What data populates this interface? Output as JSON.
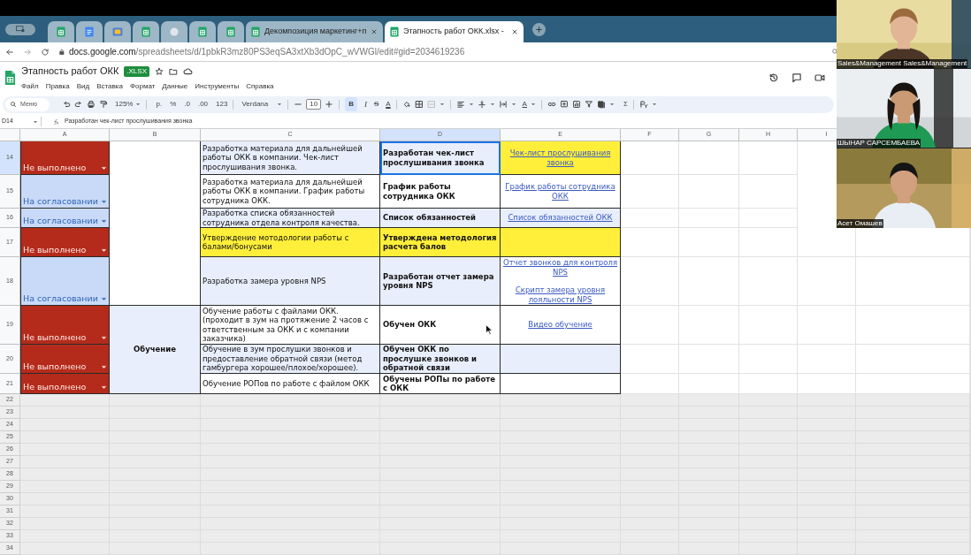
{
  "browser": {
    "tabs": [
      {
        "kind": "sheets",
        "selected": false
      },
      {
        "kind": "docs",
        "selected": false
      },
      {
        "kind": "slides",
        "selected": false
      },
      {
        "kind": "sheets",
        "selected": false
      },
      {
        "kind": "site",
        "selected": false
      },
      {
        "kind": "sheets",
        "selected": false
      },
      {
        "kind": "sheets",
        "selected": false
      },
      {
        "kind": "sheets",
        "title": "Декомпозиция маркетинг+п",
        "selected": false
      },
      {
        "kind": "sheets",
        "title": "Этапность работ ОКК.xlsx -",
        "selected": true
      }
    ],
    "address": {
      "host": "docs.google.com",
      "path": "/spreadsheets/d/1pbkR3mz80PS3eqSA3xtXb3dOpC_wVWGl/edit#gid=2034619236"
    }
  },
  "document": {
    "title": "Этапность работ ОКК",
    "badge": ".XLSX"
  },
  "menu": [
    "Файл",
    "Правка",
    "Вид",
    "Вставка",
    "Формат",
    "Данные",
    "Инструменты",
    "Справка"
  ],
  "toolbar": {
    "search": "Меню",
    "zoom": "125%",
    "currency": "р.",
    "percent": "%",
    "decimal_less": ".0",
    "decimal_more": ".00",
    "number_format": "123",
    "font": "Verdana",
    "font_size": "10",
    "bold": {
      "label": "B",
      "on": true
    },
    "italic": "I",
    "strikethrough": "S",
    "text_color": "A",
    "text_rotation": "A",
    "functions": "Σ"
  },
  "formula_bar": {
    "cell": "D14",
    "value": "Разработан чек-лист прослушивания звонка"
  },
  "columns": [
    {
      "label": "A",
      "selected": false
    },
    {
      "label": "B",
      "selected": false
    },
    {
      "label": "C",
      "selected": false
    },
    {
      "label": "D",
      "selected": true
    },
    {
      "label": "E",
      "selected": false
    },
    {
      "label": "F",
      "selected": false
    },
    {
      "label": "G",
      "selected": false
    },
    {
      "label": "H",
      "selected": false
    },
    {
      "label": "I",
      "selected": false
    }
  ],
  "sections": [
    {
      "rows": [
        {
          "number": "14",
          "selected": true,
          "status": {
            "text": "Не выполнено",
            "kind": "not_done"
          },
          "task": {
            "text": "Разработка материала для дальнейшей работы ОКК в компании. Чек-лист прослушивания звонка.",
            "color": "#e8eefb"
          },
          "result": {
            "text": "Разработан чек-лист прослушивания звонка",
            "color": "#e8eefb",
            "selected": true
          },
          "links": {
            "items": [
              "Чек-лист прослушивания звонка"
            ],
            "color": "#ffef3a"
          }
        },
        {
          "number": "15",
          "selected": false,
          "status": {
            "text": "На согласовании",
            "kind": "in_review"
          },
          "task": {
            "text": "Разработка материала для дальнейшей работы ОКК в компании. График работы сотрудника ОКК.",
            "color": "#ffffff"
          },
          "result": {
            "text": "График работы сотрудника ОКК",
            "color": "#ffffff",
            "selected": false
          },
          "links": {
            "items": [
              "График работы сотрудника ОКК"
            ],
            "color": "#ffffff"
          }
        },
        {
          "number": "16",
          "selected": false,
          "status": {
            "text": "На согласовании",
            "kind": "in_review"
          },
          "task": {
            "text": "Разработка списка обязанностей сотрудника отдела контроля качества.",
            "color": "#e8eefb"
          },
          "result": {
            "text": "Список обязанностей",
            "color": "#e8eefb",
            "selected": false
          },
          "links": {
            "items": [
              "Список обязанностей ОКК"
            ],
            "color": "#e8eefb"
          }
        },
        {
          "number": "17",
          "selected": false,
          "status": {
            "text": "Не выполнено",
            "kind": "not_done"
          },
          "task": {
            "text": "Утверждение мотодологии работы с балами/бонусами",
            "color": "#ffef3a"
          },
          "result": {
            "text": "Утверждена методология расчета балов",
            "color": "#ffef3a",
            "selected": false
          },
          "links": {
            "color": "#ffef3a"
          }
        },
        {
          "number": "18",
          "selected": false,
          "status": {
            "text": "На согласовании",
            "kind": "in_review"
          },
          "task": {
            "text": "Разработка замера уровня NPS",
            "color": "#e8eefb"
          },
          "result": {
            "text": "Разработан отчет замера уровня NPS",
            "color": "#e8eefb",
            "selected": false
          },
          "links": {
            "items": [
              "Отчет звонков для контроля NPS",
              "Скрипт замера уровня лояльности NPS"
            ],
            "color": "#ffffff"
          }
        }
      ]
    },
    {
      "label": "Обучение",
      "rows": [
        {
          "number": "19",
          "selected": false,
          "status": {
            "text": "Не выполнено",
            "kind": "not_done"
          },
          "task": {
            "text": "Обучение работы с файлами ОКК. (проходит в зум на протяжение 2 часов с ответственным за ОКК и с компании заказчика)",
            "color": "#ffffff"
          },
          "result": {
            "text": "Обучен ОКК",
            "color": "#ffffff",
            "selected": false
          },
          "links": {
            "items": [
              "Видео обучение"
            ],
            "color": "#ffffff"
          }
        },
        {
          "number": "20",
          "selected": false,
          "status": {
            "text": "Не выполнено",
            "kind": "not_done"
          },
          "task": {
            "text": "Обучение в зум прослушки звонков и предоставление обратной связи (метод гамбургера хорошее/плохое/хорошее).",
            "color": "#e8eefb"
          },
          "result": {
            "text": "Обучен ОКК по прослушке звонков и обратной связи",
            "color": "#e8eefb",
            "selected": false
          },
          "links": {
            "color": "#e8eefb"
          }
        },
        {
          "number": "21",
          "selected": false,
          "status": {
            "text": "Не выполнено",
            "kind": "not_done"
          },
          "task": {
            "text": "Обучение РОПов по работе с файлом ОКК",
            "color": "#ffffff"
          },
          "result": {
            "text": "Обучены РОПы по работе с ОКК",
            "color": "#ffffff",
            "selected": false
          },
          "links": {
            "color": "#ffffff"
          }
        }
      ]
    }
  ],
  "empty_rows": [
    "22",
    "23",
    "24",
    "25",
    "26",
    "27",
    "28",
    "29",
    "30",
    "31",
    "32",
    "33",
    "34"
  ],
  "call": {
    "participants": [
      {
        "name": "Sales&Management Sales&Management"
      },
      {
        "name": "ШЫНАР САРСЕМБАЕВА"
      },
      {
        "name": "Асет Омашев"
      }
    ]
  }
}
